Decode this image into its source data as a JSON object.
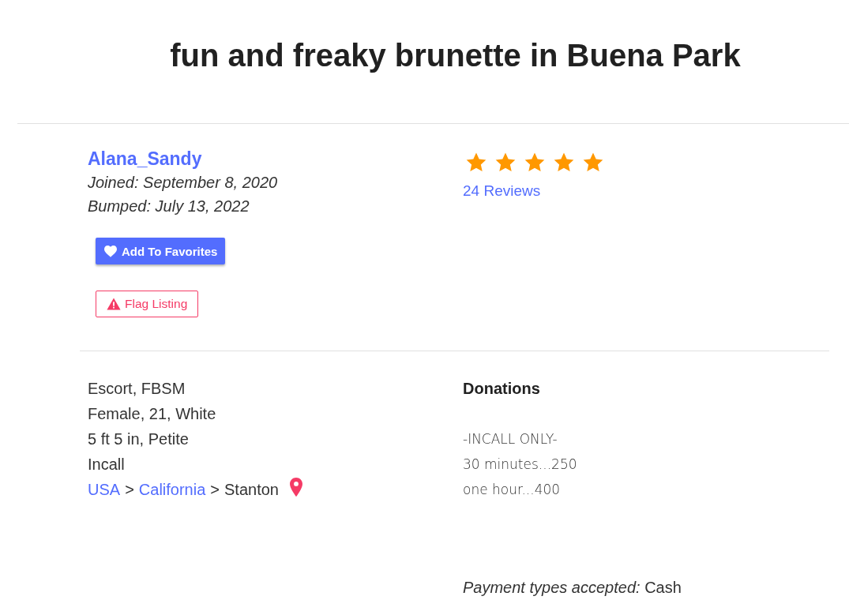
{
  "listing_title": "fun and freaky brunette in Buena Park",
  "profile": {
    "username": "Alana_Sandy",
    "joined": "Joined: September 8, 2020",
    "bumped": "Bumped: July 13, 2022"
  },
  "actions": [
    {
      "kind": "favorite",
      "label": "Add To Favorites"
    },
    {
      "kind": "flag",
      "label": "Flag Listing"
    }
  ],
  "rating": {
    "stars": 5,
    "reviews": "24 Reviews"
  },
  "details": {
    "lines": [
      "Escort, FBSM",
      "Female, 21, White",
      "5 ft 5 in, Petite",
      "Incall"
    ],
    "location": [
      {
        "kind": "link",
        "text": "USA"
      },
      {
        "kind": "separator",
        "text": ">"
      },
      {
        "kind": "link",
        "text": "California"
      },
      {
        "kind": "separator",
        "text": ">"
      },
      {
        "kind": "text",
        "text": "Stanton"
      }
    ]
  },
  "donations": {
    "heading": "Donations",
    "lines": [
      "-INCALL ONLY-",
      "30 minutes...250",
      "one hour...400"
    ],
    "payment": "*Payment types accepted:* Cash"
  }
}
